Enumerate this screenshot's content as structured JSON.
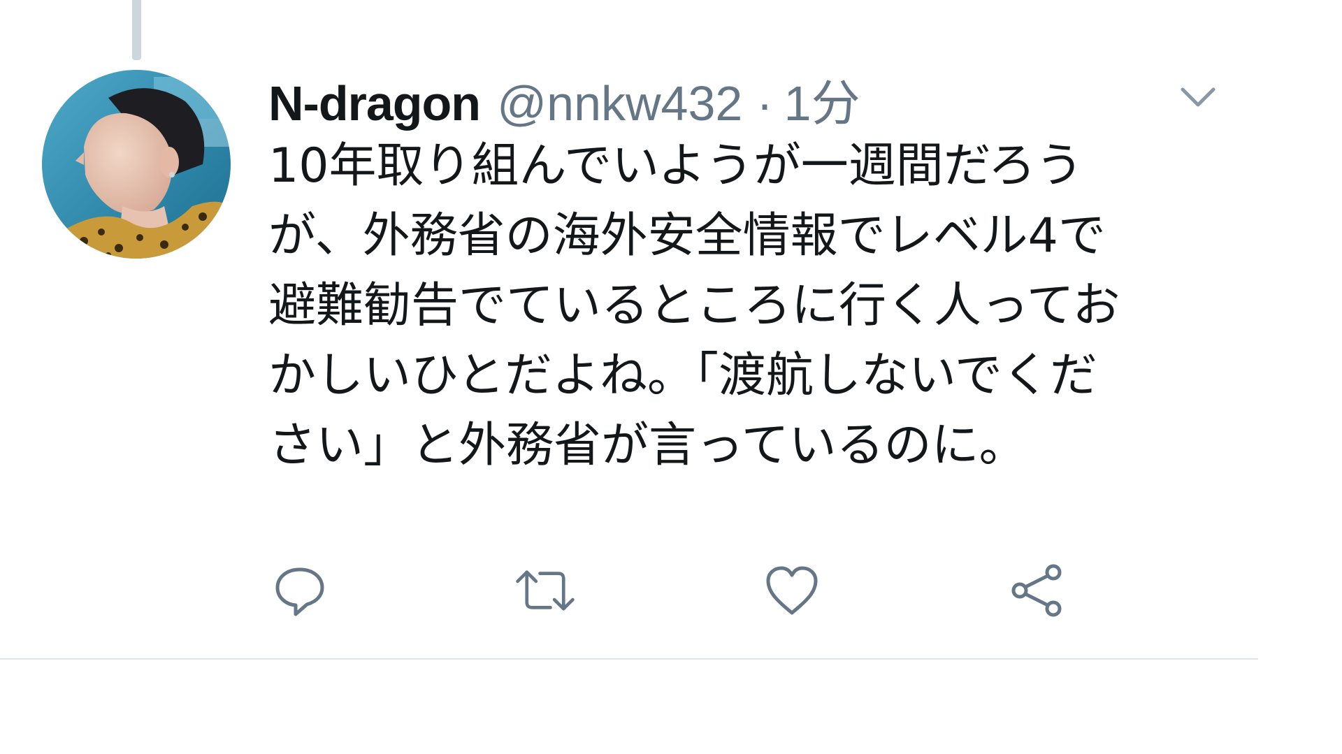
{
  "tweet": {
    "display_name": "N-dragon",
    "handle": "@nnkw432",
    "separator": "·",
    "timestamp": "1分",
    "text_lines": [
      "10年取り組んでいようが一週間だろう",
      "が、外務省の海外安全情報でレベル4で",
      "避難勧告でているところに行く人ってお",
      "かしいひとだよね。「渡航しないでくだ",
      "さい」と外務省が言っているのに。"
    ]
  },
  "icons": {
    "menu": "chevron-down-icon",
    "reply": "reply-icon",
    "retweet": "retweet-icon",
    "like": "heart-icon",
    "share": "share-icon"
  },
  "colors": {
    "text": "#14171a",
    "secondary": "#657786",
    "icon": "#657786",
    "thread_line": "#ccd6dd",
    "divider": "#e1e8ed"
  }
}
